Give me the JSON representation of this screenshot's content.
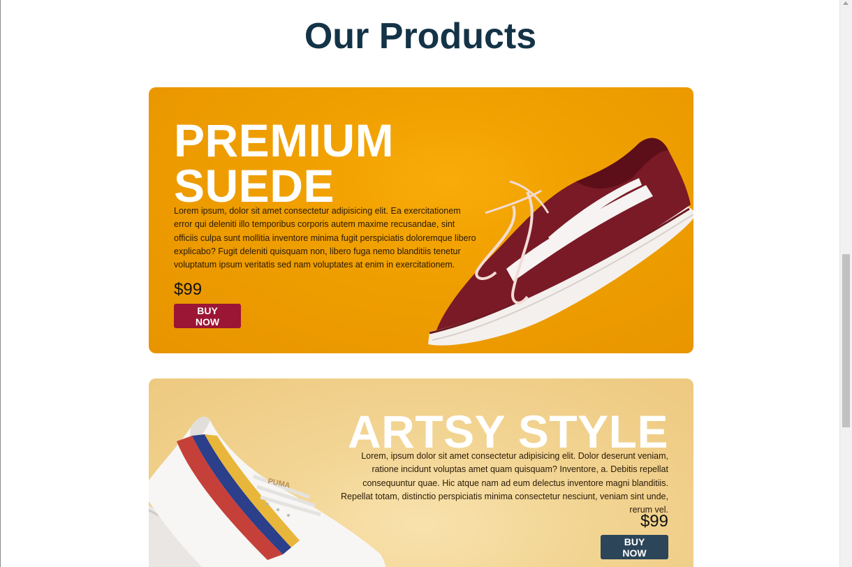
{
  "page": {
    "title": "Our Products"
  },
  "products": [
    {
      "heading": "PREMIUM SUEDE",
      "description": "Lorem ipsum, dolor sit amet consectetur adipisicing elit. Ea exercitationem error qui deleniti illo temporibus corporis autem maxime recusandae, sint officiis culpa sunt mollitia inventore minima fugit perspiciatis doloremque libero explicabo? Fugit deleniti quisquam non, libero fuga nemo blanditiis tenetur voluptatum ipsum veritatis sed nam voluptates at enim in exercitationem.",
      "price": "$99",
      "button_label": "BUY NOW",
      "image_icon": "maroon-sneaker-image",
      "accent_color": "#f0a000",
      "button_color": "#9b1535"
    },
    {
      "heading": "ARTSY STYLE",
      "description": "Lorem, ipsum dolor sit amet consectetur adipisicing elit. Dolor deserunt veniam, ratione incidunt voluptas amet quam quisquam? Inventore, a. Debitis repellat consequuntur quae. Hic atque nam ad eum delectus inventore magni blanditiis. Repellat totam, distinctio perspiciatis minima consectetur nesciunt, veniam sint unde, rerum vel.",
      "price": "$99",
      "button_label": "BUY NOW",
      "image_icon": "white-patterned-sneaker-image",
      "shoe_brand_text": "PUMA",
      "accent_color": "#f2d492",
      "button_color": "#2c4559"
    }
  ],
  "colors": {
    "title": "#143347"
  }
}
